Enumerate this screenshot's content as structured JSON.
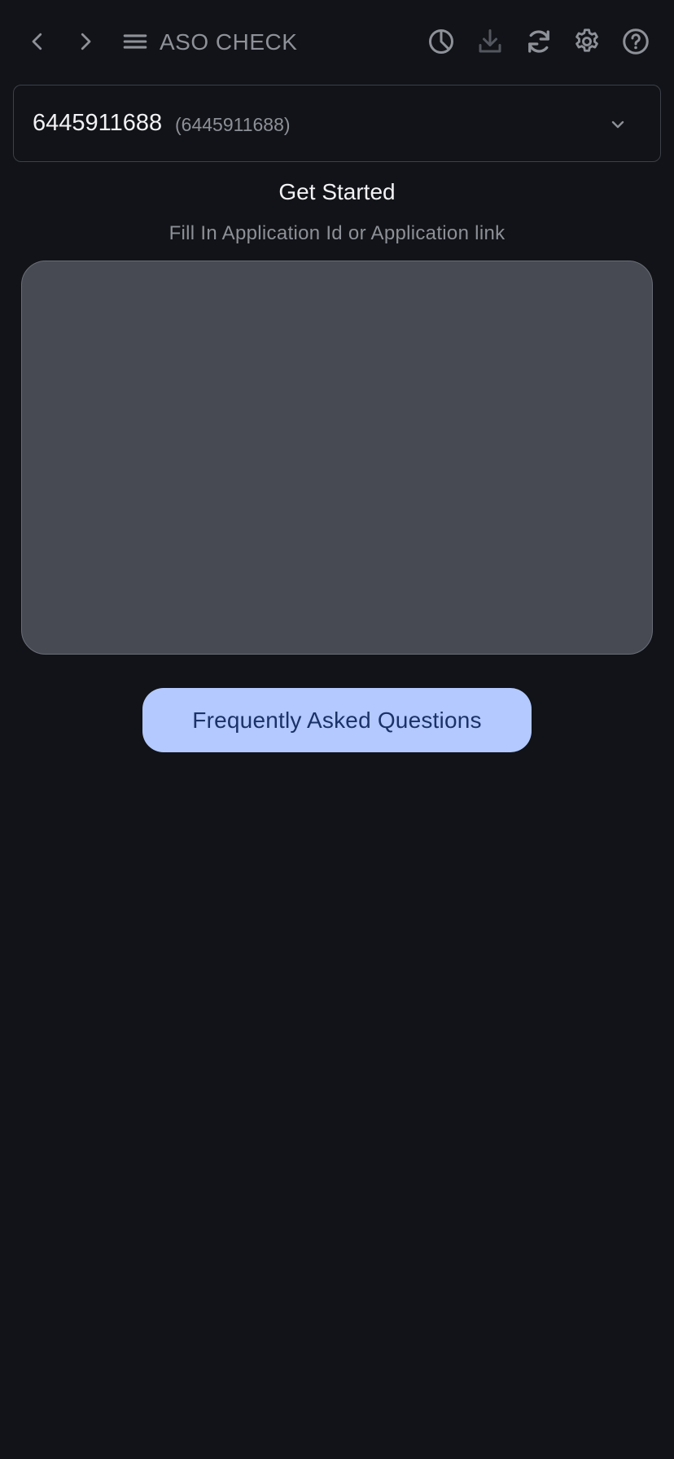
{
  "header": {
    "title": "ASO CHECK",
    "icons": {
      "back": "chevron-left-icon",
      "forward": "chevron-right-icon",
      "menu": "menu-icon",
      "stats": "pie-chart-icon",
      "download": "download-icon",
      "refresh": "refresh-icon",
      "settings": "gear-icon",
      "help": "help-circle-icon"
    }
  },
  "selector": {
    "primary": "6445911688",
    "secondary": "(6445911688)"
  },
  "get_started": {
    "heading": "Get Started",
    "subheading": "Fill In Application Id or Application link"
  },
  "input": {
    "value": "",
    "placeholder": ""
  },
  "faq": {
    "label": "Frequently Asked Questions"
  },
  "colors": {
    "background": "#111318",
    "input_fill": "#474a53",
    "button_fill": "#b3c9ff",
    "button_text": "#1b3268",
    "muted_text": "#8e9098"
  }
}
